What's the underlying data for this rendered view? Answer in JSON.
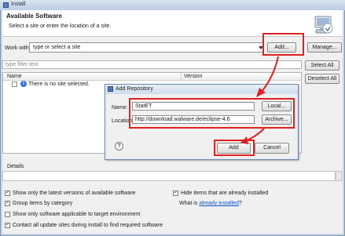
{
  "window": {
    "title": "Install"
  },
  "banner": {
    "title": "Available Software",
    "subtitle": "Select a site or enter the location of a site."
  },
  "work_with": {
    "label": "Work with:",
    "value": "type or select a site",
    "add_label": "Add...",
    "manage_label": "Manage..."
  },
  "filter": {
    "placeholder": "type filter text"
  },
  "buttons": {
    "select_all": "Select All",
    "deselect_all": "Deselect All"
  },
  "tree": {
    "columns": [
      "Name",
      "Version"
    ],
    "empty_message": "There is no site selected."
  },
  "details": {
    "label": "Details"
  },
  "options": {
    "show_latest": "Show only the latest versions of available software",
    "group_by_category": "Group items by category",
    "show_applicable": "Show only software applicable to target environment",
    "contact_all": "Contact all update sites during install to find required software",
    "hide_installed": "Hide items that are already installed",
    "what_is": "What is",
    "already_installed_link": "already installed",
    "question_mark": "?"
  },
  "dialog": {
    "title": "Add Repository",
    "name_label": "Name:",
    "name_value": "StatET",
    "local_label": "Local...",
    "location_label": "Location:",
    "location_value": "http://download.walware.de/eclipse-4.6",
    "archive_label": "Archive...",
    "add_label": "Add",
    "cancel_label": "Cancel"
  },
  "colors": {
    "annotation": "#e02020",
    "link": "#0b55c4"
  }
}
